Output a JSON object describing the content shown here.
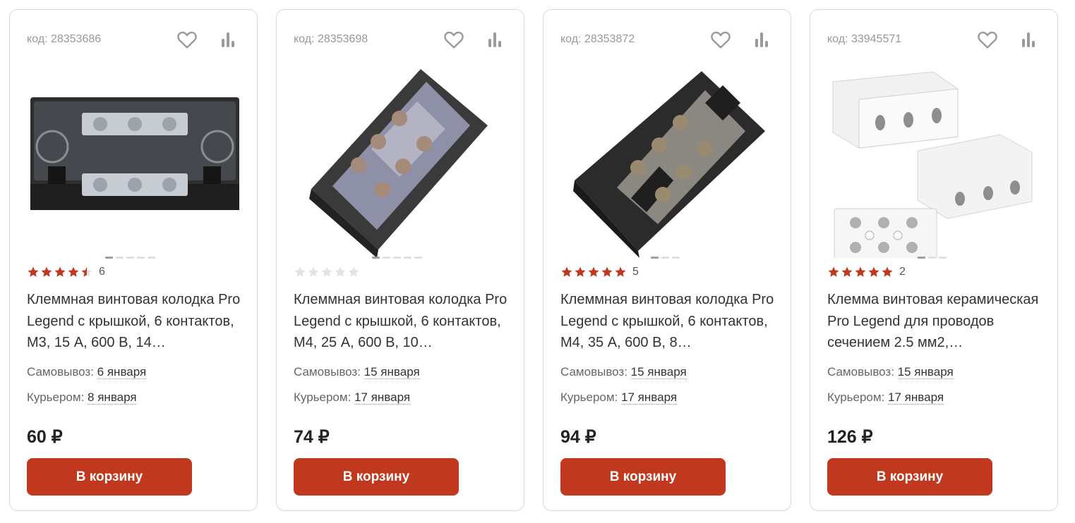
{
  "colors": {
    "accent": "#c0391f",
    "star_filled": "#c0391f",
    "star_empty": "#e3e3e3",
    "muted_text": "#999999"
  },
  "icons": {
    "favorite": "heart-outline-icon",
    "compare": "bar-chart-icon",
    "star": "star-icon"
  },
  "products": [
    {
      "code": "код: 28353686",
      "rating": 4.5,
      "review_count": "6",
      "title": "Клеммная винтовая колодка Pro Legend с крышкой, 6 контактов, М3, 15 А, 600 В, 14…",
      "pickup_label": "Самовывоз:",
      "pickup_date": "6 января",
      "courier_label": "Курьером:",
      "courier_date": "8 января",
      "price": "60 ₽",
      "cart_button": "В корзину",
      "gallery_total": 5,
      "gallery_active": 1
    },
    {
      "code": "код: 28353698",
      "rating": 0,
      "review_count": "",
      "title": "Клеммная винтовая колодка Pro Legend с крышкой, 6 контактов, М4, 25 А, 600 В, 10…",
      "pickup_label": "Самовывоз:",
      "pickup_date": "15 января",
      "courier_label": "Курьером:",
      "courier_date": "17 января",
      "price": "74 ₽",
      "cart_button": "В корзину",
      "gallery_total": 5,
      "gallery_active": 1
    },
    {
      "code": "код: 28353872",
      "rating": 5,
      "review_count": "5",
      "title": "Клеммная винтовая колодка Pro Legend с крышкой, 6 контактов, М4, 35 А, 600 В, 8…",
      "pickup_label": "Самовывоз:",
      "pickup_date": "15 января",
      "courier_label": "Курьером:",
      "courier_date": "17 января",
      "price": "94 ₽",
      "cart_button": "В корзину",
      "gallery_total": 3,
      "gallery_active": 1
    },
    {
      "code": "код: 33945571",
      "rating": 5,
      "review_count": "2",
      "title": "Клемма винтовая керамическая Pro Legend для проводов сечением 2.5 мм2,…",
      "pickup_label": "Самовывоз:",
      "pickup_date": "15 января",
      "courier_label": "Курьером:",
      "courier_date": "17 января",
      "price": "126 ₽",
      "cart_button": "В корзину",
      "gallery_total": 3,
      "gallery_active": 1
    }
  ]
}
